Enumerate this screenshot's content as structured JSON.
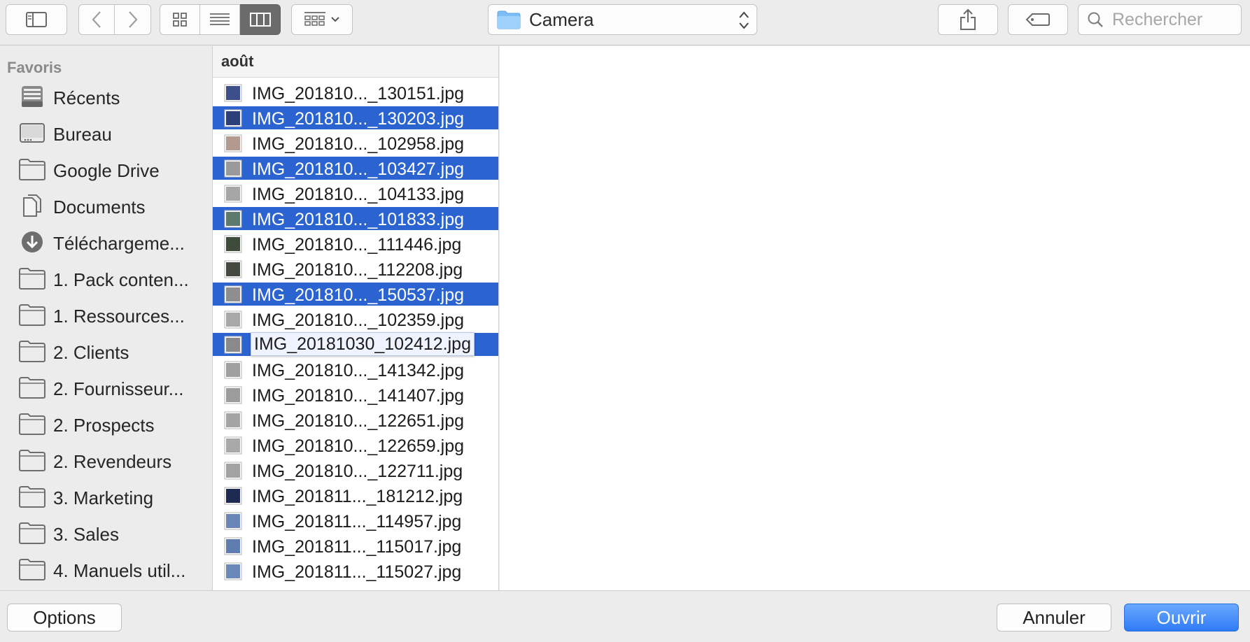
{
  "toolbar": {
    "location": "Camera",
    "search_placeholder": "Rechercher"
  },
  "sidebar": {
    "heading": "Favoris",
    "items": [
      {
        "label": "Récents",
        "icon": "recents-icon"
      },
      {
        "label": "Bureau",
        "icon": "desktop-icon"
      },
      {
        "label": "Google Drive",
        "icon": "folder-icon"
      },
      {
        "label": "Documents",
        "icon": "documents-icon"
      },
      {
        "label": "Téléchargeme...",
        "icon": "download-icon"
      },
      {
        "label": "1. Pack conten...",
        "icon": "folder-icon"
      },
      {
        "label": "1. Ressources...",
        "icon": "folder-icon"
      },
      {
        "label": "2. Clients",
        "icon": "folder-icon"
      },
      {
        "label": "2. Fournisseur...",
        "icon": "folder-icon"
      },
      {
        "label": "2. Prospects",
        "icon": "folder-icon"
      },
      {
        "label": "2. Revendeurs",
        "icon": "folder-icon"
      },
      {
        "label": "3. Marketing",
        "icon": "folder-icon"
      },
      {
        "label": "3. Sales",
        "icon": "folder-icon"
      },
      {
        "label": "4. Manuels util...",
        "icon": "folder-icon"
      }
    ]
  },
  "column": {
    "header": "août",
    "files": [
      {
        "name": "IMG_201810..._130151.jpg",
        "selected": false,
        "thumb": "#3c4f8a"
      },
      {
        "name": "IMG_201810..._130203.jpg",
        "selected": true,
        "thumb": "#2c3f78"
      },
      {
        "name": "IMG_201810..._102958.jpg",
        "selected": false,
        "thumb": "#b29a8e"
      },
      {
        "name": "IMG_201810..._103427.jpg",
        "selected": true,
        "thumb": "#9a9a9a"
      },
      {
        "name": "IMG_201810..._104133.jpg",
        "selected": false,
        "thumb": "#a6a6a6"
      },
      {
        "name": "IMG_201810..._101833.jpg",
        "selected": true,
        "thumb": "#5e7a6e"
      },
      {
        "name": "IMG_201810..._111446.jpg",
        "selected": false,
        "thumb": "#3e4a3a"
      },
      {
        "name": "IMG_201810..._112208.jpg",
        "selected": false,
        "thumb": "#444a40"
      },
      {
        "name": "IMG_201810..._150537.jpg",
        "selected": true,
        "thumb": "#8e8e8e"
      },
      {
        "name": "IMG_201810..._102359.jpg",
        "selected": false,
        "thumb": "#a8a8a8"
      },
      {
        "name": "IMG_20181030_102412.jpg",
        "selected": true,
        "thumb": "#8a8a8a",
        "expanded": true
      },
      {
        "name": "IMG_201810..._141342.jpg",
        "selected": false,
        "thumb": "#a0a0a0"
      },
      {
        "name": "IMG_201810..._141407.jpg",
        "selected": false,
        "thumb": "#9c9c9c"
      },
      {
        "name": "IMG_201810..._122651.jpg",
        "selected": false,
        "thumb": "#a4a4a4"
      },
      {
        "name": "IMG_201810..._122659.jpg",
        "selected": false,
        "thumb": "#a9a9a9"
      },
      {
        "name": "IMG_201810..._122711.jpg",
        "selected": false,
        "thumb": "#a2a2a2"
      },
      {
        "name": "IMG_201811..._181212.jpg",
        "selected": false,
        "thumb": "#1d2a52"
      },
      {
        "name": "IMG_201811..._114957.jpg",
        "selected": false,
        "thumb": "#6a86b8"
      },
      {
        "name": "IMG_201811..._115017.jpg",
        "selected": false,
        "thumb": "#5f7db0"
      },
      {
        "name": "IMG_201811..._115027.jpg",
        "selected": false,
        "thumb": "#6b88ba"
      }
    ]
  },
  "footer": {
    "options_label": "Options",
    "cancel_label": "Annuler",
    "open_label": "Ouvrir"
  }
}
